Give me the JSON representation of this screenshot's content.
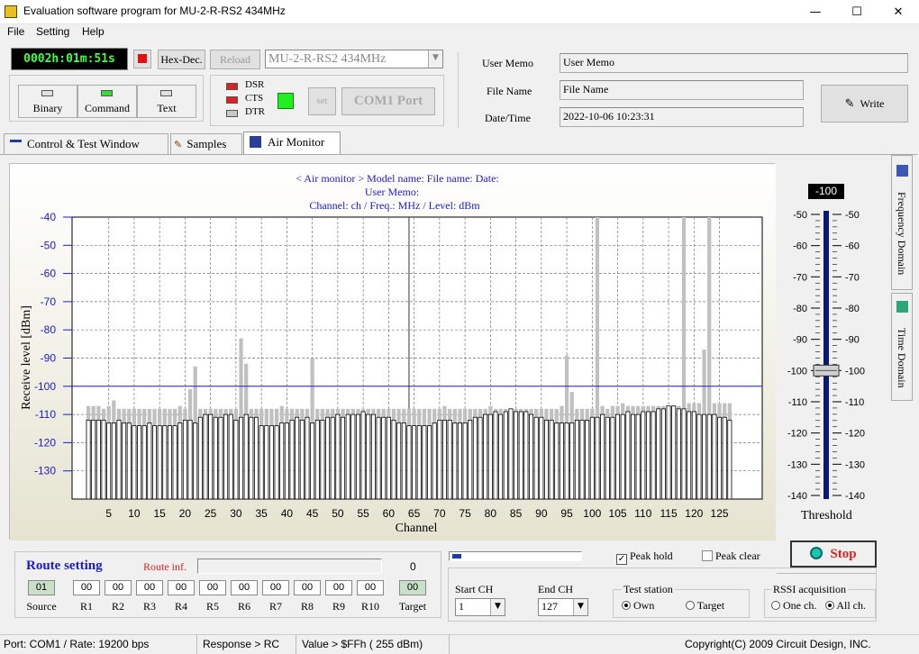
{
  "window": {
    "title": "Evaluation software program for MU-2-R-RS2  434MHz"
  },
  "menu": [
    "File",
    "Setting",
    "Help"
  ],
  "toolbar": {
    "timer": "0002h:01m:51s",
    "hexdec_label": "Hex-Dec.",
    "reload_label": "Reload",
    "model_select": "MU-2-R-RS2  434MHz",
    "modes": [
      {
        "label": "Binary",
        "lamp": "#e0e0e0"
      },
      {
        "label": "Command",
        "lamp": "#33dd33"
      },
      {
        "label": "Text",
        "lamp": "#e0e0e0"
      }
    ],
    "signals": [
      {
        "label": "DSR",
        "color": "#e02020"
      },
      {
        "label": "CTS",
        "color": "#e02020"
      },
      {
        "label": "DTR",
        "color": "#c8c8c8"
      }
    ],
    "set_label": "set",
    "port_label": "COM1 Port",
    "write_label": "Write"
  },
  "info": {
    "user_memo_label": "User Memo",
    "user_memo_value": "User Memo",
    "file_name_label": "File Name",
    "file_name_value": "File Name",
    "datetime_label": "Date/Time",
    "datetime_value": "2022-10-06 10:23:31"
  },
  "tabs": [
    "Control  & Test Window",
    "Samples",
    "Air Monitor"
  ],
  "side_tabs": [
    "Frequency Domain",
    "Time Domain"
  ],
  "chart_header": {
    "line1": "< Air monitor >   Model name:    File name:     Date:",
    "line2": "User Memo:",
    "line3": "Channel:  ch  /  Freq.:      MHz  /  Level:   dBm"
  },
  "chart_data": {
    "type": "bar",
    "xlabel": "Channel",
    "ylabel": "Receive level [dBm]",
    "ylim": [
      -140,
      -40
    ],
    "yticks": [
      -40,
      -50,
      -60,
      -70,
      -80,
      -90,
      -100,
      -110,
      -120,
      -130
    ],
    "xticks": [
      5,
      10,
      15,
      20,
      25,
      30,
      35,
      40,
      45,
      50,
      55,
      60,
      65,
      70,
      75,
      80,
      85,
      90,
      95,
      100,
      105,
      110,
      115,
      120,
      125
    ],
    "threshold": -100,
    "x_start": 1,
    "x_end": 127,
    "series": [
      {
        "values": [
          -112,
          -112,
          -112,
          -112,
          -113,
          -113,
          -112,
          -113,
          -113,
          -114,
          -114,
          -114,
          -113,
          -114,
          -114,
          -114,
          -114,
          -114,
          -113,
          -112,
          -112,
          -113,
          -111,
          -110,
          -110,
          -111,
          -111,
          -110,
          -110,
          -112,
          -111,
          -110,
          -111,
          -111,
          -114,
          -114,
          -114,
          -114,
          -113,
          -113,
          -112,
          -111,
          -112,
          -111,
          -113,
          -112,
          -112,
          -111,
          -111,
          -110,
          -111,
          -110,
          -110,
          -110,
          -109,
          -110,
          -110,
          -111,
          -111,
          -111,
          -112,
          -113,
          -113,
          -114,
          -114,
          -114,
          -114,
          -114,
          -113,
          -112,
          -112,
          -112,
          -113,
          -113,
          -113,
          -112,
          -111,
          -111,
          -110,
          -110,
          -109,
          -110,
          -109,
          -108,
          -109,
          -109,
          -109,
          -110,
          -111,
          -111,
          -112,
          -112,
          -113,
          -113,
          -113,
          -113,
          -112,
          -112,
          -112,
          -111,
          -111,
          -110,
          -111,
          -111,
          -110,
          -110,
          -109,
          -110,
          -110,
          -109,
          -109,
          -109,
          -108,
          -108,
          -107,
          -107,
          -108,
          -108,
          -109,
          -109,
          -110,
          -110,
          -110,
          -110,
          -111,
          -111,
          -112
        ]
      },
      {
        "values": [
          -107,
          -107,
          -107,
          -108,
          -107,
          -105,
          -108,
          -108,
          -108,
          -108,
          -108,
          -108,
          -108,
          -108,
          -108,
          -108,
          -108,
          -108,
          -107,
          -108,
          -101,
          -93,
          -108,
          -108,
          -108,
          -108,
          -108,
          -108,
          -108,
          -108,
          -83,
          -92,
          -108,
          -108,
          -108,
          -108,
          -108,
          -108,
          -107,
          -108,
          -108,
          -108,
          -108,
          -108,
          -90,
          -108,
          -108,
          -108,
          -108,
          -108,
          -108,
          -108,
          -108,
          -108,
          -108,
          -108,
          -108,
          -108,
          -108,
          -108,
          -108,
          -108,
          -108,
          -108,
          -108,
          -108,
          -108,
          -108,
          -108,
          -108,
          -107,
          -108,
          -108,
          -108,
          -108,
          -108,
          -108,
          -108,
          -108,
          -107,
          -108,
          -108,
          -108,
          -108,
          -108,
          -108,
          -108,
          -108,
          -108,
          -108,
          -108,
          -108,
          -108,
          -107,
          -89,
          -102,
          -108,
          -108,
          -108,
          -108,
          -40,
          -107,
          -108,
          -107,
          -107,
          -106,
          -107,
          -107,
          -107,
          -107,
          -107,
          -107,
          -107,
          -107,
          -107,
          -107,
          -107,
          -40,
          -106,
          -106,
          -106,
          -87,
          -40,
          -106,
          -106,
          -106,
          -106
        ]
      }
    ]
  },
  "threshold_panel": {
    "value": "-100",
    "label": "Threshold",
    "ticks": [
      -50,
      -60,
      -70,
      -80,
      -90,
      -100,
      -110,
      -120,
      -130,
      -140
    ],
    "level": -100
  },
  "route": {
    "title": "Route setting",
    "inf_label": "Route inf.",
    "count": "0",
    "cells": [
      {
        "label": "Source",
        "value": "01"
      },
      {
        "label": "R1",
        "value": "00"
      },
      {
        "label": "R2",
        "value": "00"
      },
      {
        "label": "R3",
        "value": "00"
      },
      {
        "label": "R4",
        "value": "00"
      },
      {
        "label": "R5",
        "value": "00"
      },
      {
        "label": "R6",
        "value": "00"
      },
      {
        "label": "R7",
        "value": "00"
      },
      {
        "label": "R8",
        "value": "00"
      },
      {
        "label": "R9",
        "value": "00"
      },
      {
        "label": "R10",
        "value": "00"
      },
      {
        "label": "Target",
        "value": "00"
      }
    ]
  },
  "controls": {
    "peak_hold": "Peak hold",
    "peak_clear": "Peak clear",
    "stop": "Stop",
    "start_ch_label": "Start CH",
    "start_ch_value": "1",
    "end_ch_label": "End CH",
    "end_ch_value": "127",
    "test_station_label": "Test station",
    "own": "Own",
    "target": "Target",
    "rssi_label": "RSSI acquisition",
    "one_ch": "One ch.",
    "all_ch": "All ch."
  },
  "status": {
    "port": "Port: COM1 / Rate: 19200 bps",
    "response": "Response > RC",
    "value": "Value > $FFh ( 255 dBm)",
    "copyright": "Copyright(C) 2009 Circuit Design, INC."
  }
}
